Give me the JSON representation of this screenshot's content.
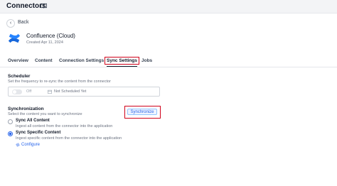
{
  "header": {
    "title": "Connectors",
    "help_icon": "book-icon"
  },
  "back": {
    "label": "Back",
    "icon": "chevron-left-icon"
  },
  "connector": {
    "name": "Confluence (Cloud)",
    "created": "Created Apr 11, 2024",
    "logo": "confluence-logo-icon",
    "brand_color": "#1868db"
  },
  "tabs": [
    {
      "label": "Overview"
    },
    {
      "label": "Content"
    },
    {
      "label": "Connection Settings"
    },
    {
      "label": "Sync Settings",
      "active": true
    },
    {
      "label": "Jobs"
    }
  ],
  "scheduler": {
    "title": "Scheduler",
    "description": "Set the frequency to re-sync the content from the connector",
    "toggle_label": "Off",
    "schedule_value": "Not Scheduled Yet",
    "icon": "calendar-icon"
  },
  "synchronization": {
    "title": "Synchronization",
    "description": "Select the content you want to synchronize",
    "button_label": "Synchronize",
    "options": [
      {
        "label": "Sync All Content",
        "description": "Ingest all content from the connector into the application",
        "checked": false
      },
      {
        "label": "Sync Specific Content",
        "description": "Ingest specific content from the connector into the application",
        "checked": true
      }
    ],
    "configure_label": "Configure",
    "configure_icon": "gear-icon"
  },
  "colors": {
    "highlight": "#d0021b",
    "accent": "#2563eb"
  }
}
